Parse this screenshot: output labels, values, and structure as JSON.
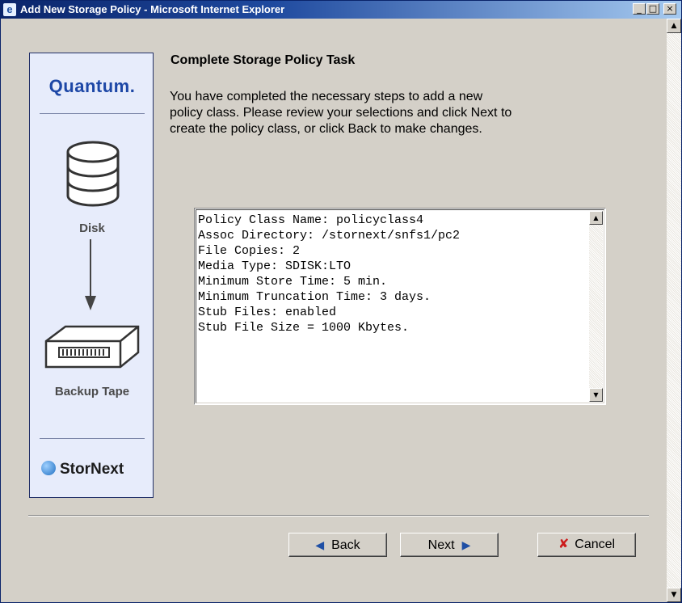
{
  "window": {
    "title": "Add New Storage Policy - Microsoft Internet Explorer",
    "controls": {
      "minimize": "_",
      "maximize": "□",
      "close": "×"
    }
  },
  "brand_panel": {
    "logo_text": "Quantum",
    "logo_dot": ".",
    "disk_label": "Disk",
    "tape_label": "Backup Tape",
    "product_name": "StorNext"
  },
  "main": {
    "heading": "Complete Storage Policy Task",
    "intro_lines": [
      "You have completed the necessary steps to add a new",
      "policy class. Please review your selections and click Next to",
      "create the policy class, or click Back to make changes."
    ],
    "summary_lines": [
      "Policy Class Name: policyclass4",
      "Assoc Directory: /stornext/snfs1/pc2",
      "File Copies: 2",
      "Media Type: SDISK:LTO",
      "Minimum Store Time: 5 min.",
      "Minimum Truncation Time: 3 days.",
      "Stub Files: enabled",
      "Stub File Size = 1000 Kbytes."
    ]
  },
  "buttons": {
    "back_label": "Back",
    "next_label": "Next",
    "cancel_label": "Cancel"
  },
  "icons": {
    "back": "arrow-left-icon",
    "next": "arrow-right-icon",
    "cancel": "x-icon"
  },
  "colors": {
    "titlebar_start": "#0a246a",
    "brand_blue": "#1d47a6",
    "panel_bg": "#e7ecfb",
    "dialog_bg": "#d4d0c8",
    "cancel_x": "#cc1b1b"
  }
}
